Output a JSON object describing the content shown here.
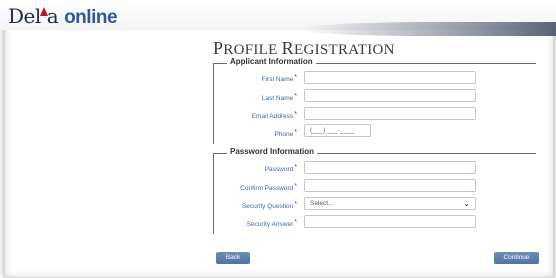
{
  "brand": {
    "logo_part1": "Del",
    "logo_part2": "a",
    "logo_part3": "online"
  },
  "page": {
    "title_cap": "P",
    "title_rest": "ROFILE ",
    "title_cap2": "R",
    "title_rest2": "EGISTRATION"
  },
  "sections": {
    "applicant": {
      "legend": "Applicant Information",
      "first_name_label": "First Name",
      "last_name_label": "Last Name",
      "email_label": "Email Address",
      "phone_label": "Phone",
      "phone_placeholder": "(___) ___-____"
    },
    "password": {
      "legend": "Password Information",
      "password_label": "Password",
      "confirm_label": "Confirm Password",
      "question_label": "Security Question",
      "question_value": "Select...",
      "answer_label": "Security Answer"
    }
  },
  "required_mark": "*",
  "buttons": {
    "back": "Back",
    "continue": "Continue"
  },
  "colors": {
    "accent": "#3d6aa8",
    "button": "#5a7cab",
    "required": "#c8102e"
  }
}
